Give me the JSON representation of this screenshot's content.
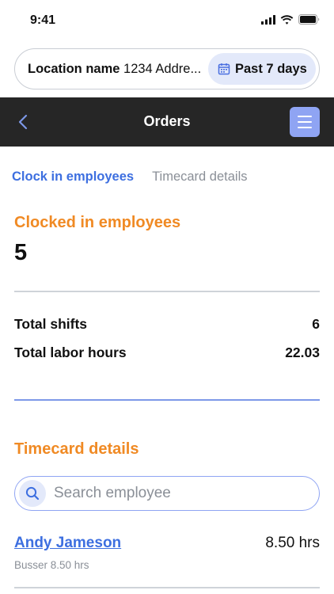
{
  "status_bar": {
    "time": "9:41",
    "icons": [
      "signal-icon",
      "wifi-icon",
      "battery-icon"
    ]
  },
  "location_bar": {
    "label": "Location name",
    "address": "1234 Addre...",
    "date_range": "Past 7 days",
    "date_icon": "calendar-icon"
  },
  "app_bar": {
    "title": "Orders",
    "back_icon": "chevron-left-icon",
    "menu_icon": "hamburger-menu-icon"
  },
  "tabs": [
    {
      "label": "Clock in employees",
      "active": true
    },
    {
      "label": "Timecard details",
      "active": false
    }
  ],
  "clocked_in": {
    "title": "Clocked in employees",
    "count": "5"
  },
  "stats": [
    {
      "label": "Total shifts",
      "value": "6"
    },
    {
      "label": "Total labor hours",
      "value": "22.03"
    }
  ],
  "timecard": {
    "title": "Timecard details",
    "search_placeholder": "Search employee",
    "employees": [
      {
        "name": "Andy Jameson",
        "hours": "8.50 hrs",
        "detail": "Busser 8.50 hrs"
      }
    ]
  },
  "colors": {
    "accent_blue": "#3d6fe0",
    "accent_orange": "#f08a24",
    "app_bar_bg": "#262626",
    "menu_button_bg": "#8fa4f3"
  }
}
